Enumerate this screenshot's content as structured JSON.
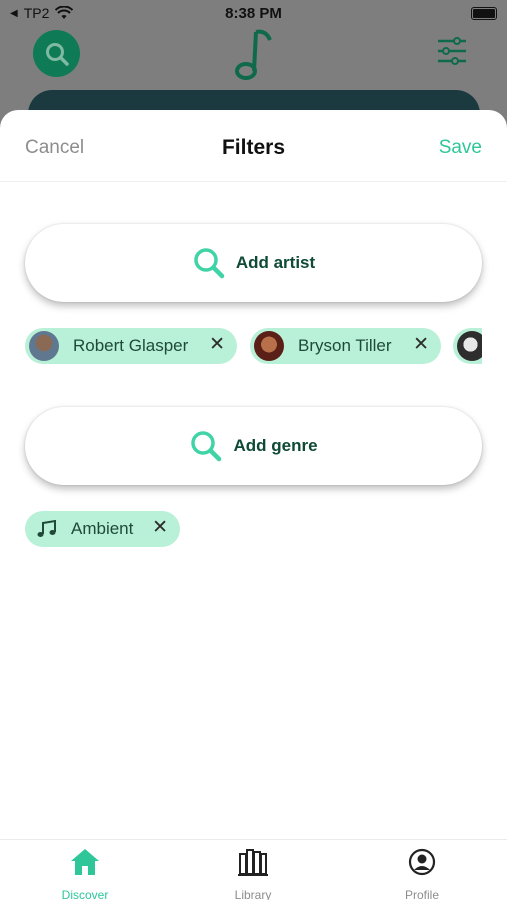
{
  "status_bar": {
    "carrier": "TP2",
    "time": "8:38 PM"
  },
  "sheet": {
    "cancel_label": "Cancel",
    "title": "Filters",
    "save_label": "Save"
  },
  "artist_section": {
    "add_label": "Add artist",
    "chips": [
      {
        "label": "Robert Glasper",
        "avatar_color": "#6b7a8a"
      },
      {
        "label": "Bryson Tiller",
        "avatar_color": "#7a3020"
      },
      {
        "label": "",
        "avatar_color": "#3a3a3a"
      }
    ]
  },
  "genre_section": {
    "add_label": "Add genre",
    "chips": [
      {
        "label": "Ambient",
        "icon": "music-note-icon"
      }
    ]
  },
  "tabbar": {
    "items": [
      {
        "label": "Discover",
        "icon": "home-icon",
        "active": true
      },
      {
        "label": "Library",
        "icon": "library-icon",
        "active": false
      },
      {
        "label": "Profile",
        "icon": "profile-icon",
        "active": false
      }
    ]
  },
  "colors": {
    "accent": "#2fc69a",
    "chip_bg": "#b9f0d8",
    "dark_green": "#0e4a35",
    "inactive": "#8d8d8d"
  }
}
